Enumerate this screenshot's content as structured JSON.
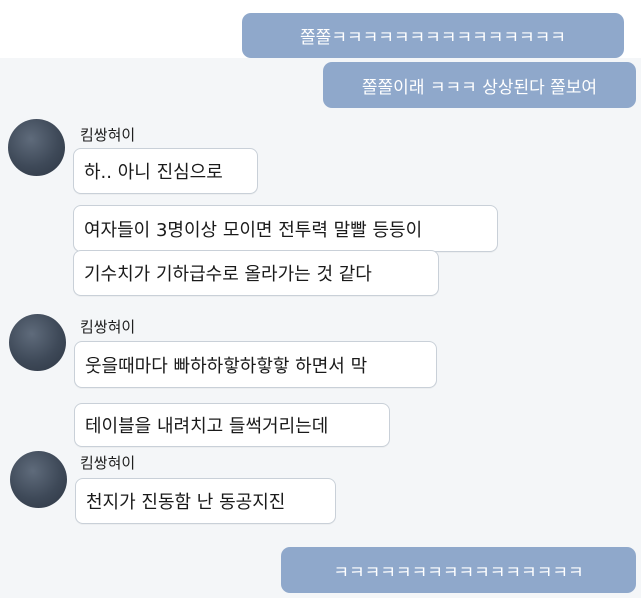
{
  "outgoing": [
    {
      "text": "쫄쫄ㅋㅋㅋㅋㅋㅋㅋㅋㅋㅋㅋㅋㅋㅋㅋ"
    },
    {
      "text": "쫄쫄이래 ㅋㅋㅋ 상상된다 쫄보여"
    },
    {
      "text": "ㅋㅋㅋㅋㅋㅋㅋㅋㅋㅋㅋㅋㅋㅋㅋㅋ"
    }
  ],
  "groups": [
    {
      "sender": "킴쌍혀이",
      "messages": [
        "하.. 아니 진심으로",
        "여자들이 3명이상 모이면 전투력 말빨 등등이",
        "기수치가 기하급수로 올라가는 것 같다"
      ]
    },
    {
      "sender": "킴쌍혀이",
      "messages": [
        "웃을때마다 빠하하핳하핳핳 하면서 막",
        "테이블을 내려치고 들썩거리는데"
      ]
    },
    {
      "sender": "킴쌍혀이",
      "messages": [
        "천지가 진동함 난 동공지진"
      ]
    }
  ],
  "colors": {
    "outgoing_bubble": "#8fa8cb",
    "incoming_bubble": "#ffffff",
    "background": "#f4f6f8"
  }
}
